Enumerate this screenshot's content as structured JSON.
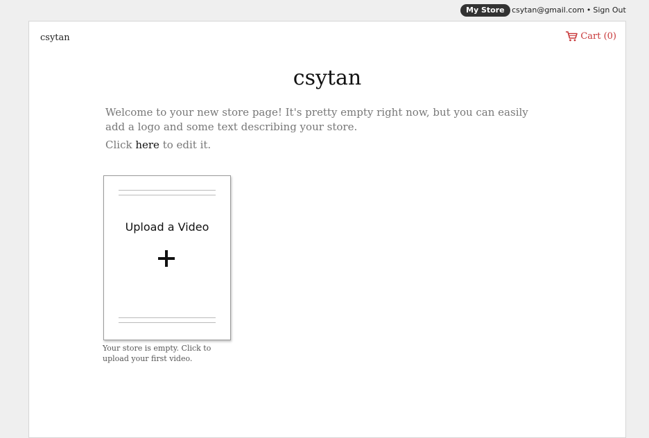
{
  "topbar": {
    "my_store_label": "My Store",
    "email": "csytan@gmail.com",
    "separator": "•",
    "sign_out_label": "Sign Out"
  },
  "header": {
    "store_name": "csytan",
    "cart_label": "Cart (0)",
    "cart_icon": "shopping-cart-icon",
    "cart_color": "#c8383a"
  },
  "main": {
    "title": "csytan",
    "welcome_text": "Welcome to your new store page! It's pretty empty right now, but you can easily add a logo and some text describing your store.",
    "click_prefix": "Click ",
    "click_link": "here",
    "click_suffix": " to edit it.",
    "upload_card": {
      "label": "Upload a Video",
      "icon": "plus-icon"
    },
    "empty_note": "Your store is empty. Click to upload your first video."
  }
}
